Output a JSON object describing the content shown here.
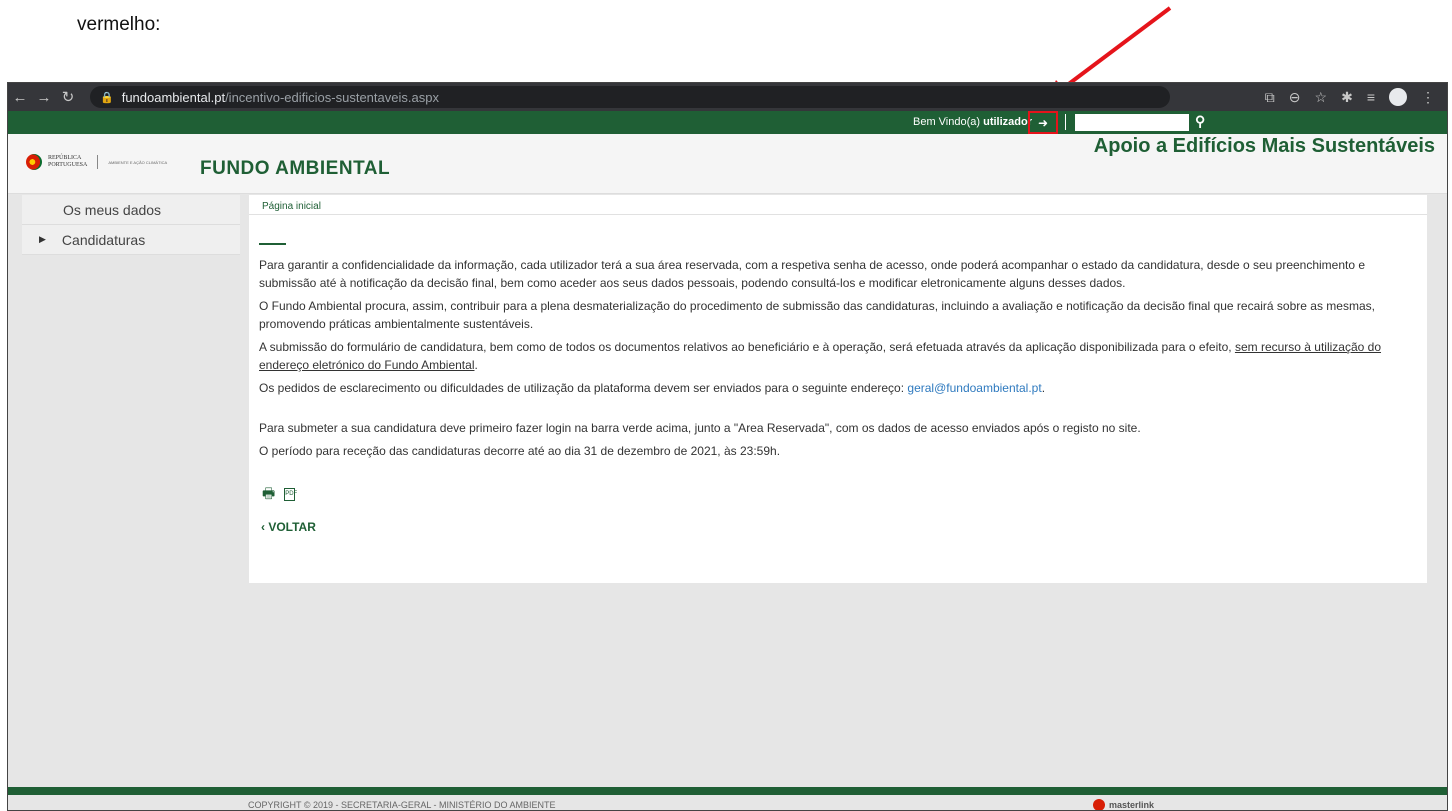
{
  "caption": "vermelho:",
  "browser": {
    "url_host": "fundoambiental.pt",
    "url_path": "/incentivo-edificios-sustentaveis.aspx"
  },
  "topbar": {
    "welcome_prefix": "Bem Vindo(a)",
    "username": "utilizador"
  },
  "header": {
    "gov_line1": "REPÚBLICA",
    "gov_line2": "PORTUGUESA",
    "gov_sub": "AMBIENTE E AÇÃO CLIMÁTICA",
    "brand": "FUNDO AMBIENTAL",
    "tagline": "Apoio a Edifícios Mais Sustentáveis"
  },
  "sidebar": {
    "items": [
      {
        "label": "Os meus dados"
      },
      {
        "label": "Candidaturas"
      }
    ]
  },
  "main": {
    "breadcrumb": "Página inicial",
    "p1": "Para garantir a confidencialidade da informação, cada utilizador terá a sua área reservada, com a respetiva senha de acesso, onde poderá acompanhar o estado da candidatura, desde o seu preenchimento e submissão até à notificação da decisão final, bem como aceder aos seus dados pessoais, podendo consultá-los e modificar eletronicamente alguns desses dados.",
    "p2": "O Fundo Ambiental procura, assim, contribuir para a plena desmaterialização do procedimento de submissão das candidaturas, incluindo a avaliação e notificação da decisão final que recairá sobre as mesmas, promovendo práticas ambientalmente sustentáveis.",
    "p3_text": "A submissão do formulário de candidatura, bem como de todos os documentos relativos ao beneficiário e à operação, será efetuada através da aplicação disponibilizada para o efeito, ",
    "p3_underlined": "sem recurso à utilização do endereço eletrónico do Fundo Ambiental",
    "p3_end": ".",
    "p4_text": "Os pedidos de esclarecimento ou dificuldades de utilização da plataforma devem ser enviados para o seguinte endereço: ",
    "p4_email": "geral@fundoambiental.pt",
    "p4_end": ".",
    "p5": "Para submeter a sua candidatura deve primeiro fazer login na barra verde acima, junto a \"Area Reservada\", com os dados de acesso enviados após o registo no site.",
    "p6": "O período para receção das candidaturas decorre até ao dia 31 de dezembro de 2021, às 23:59h.",
    "back_label": "VOLTAR"
  },
  "footer": {
    "copyright": "COPYRIGHT © 2019 - SECRETARIA-GERAL - MINISTÉRIO DO AMBIENTE",
    "partner": "masterlink"
  },
  "colors": {
    "brand_green": "#1f5f35",
    "highlight_red": "#e5141b"
  }
}
